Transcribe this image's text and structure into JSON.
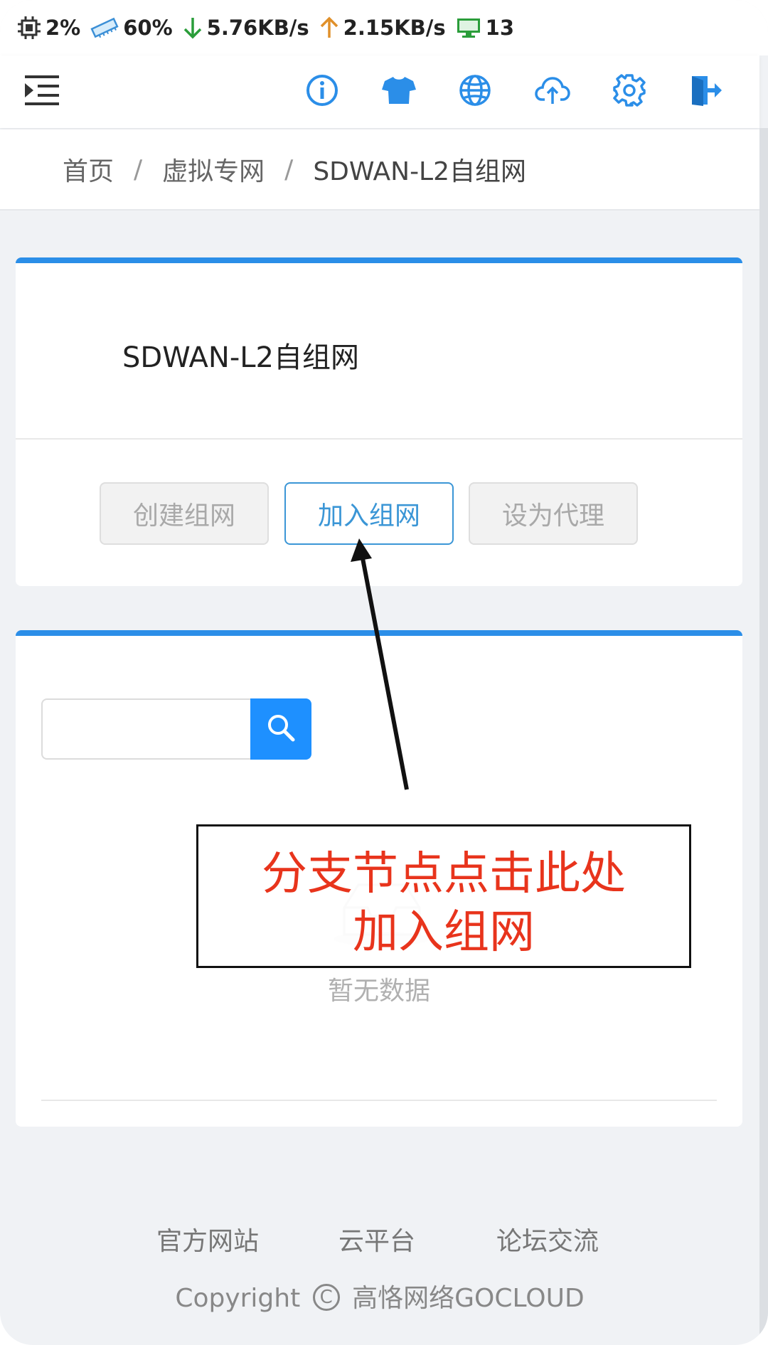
{
  "status_bar": {
    "cpu": "2%",
    "memory": "60%",
    "download": "5.76KB/s",
    "upload": "2.15KB/s",
    "devices": "13",
    "icons": [
      "cpu-icon",
      "memory-icon",
      "download-arrow-icon",
      "upload-arrow-icon",
      "monitor-icon"
    ],
    "colors": {
      "download": "#2a9d3a",
      "upload": "#e0902a",
      "devices": "#2a9d3a"
    }
  },
  "toolbar": {
    "left_icon": "menu-indent-icon",
    "right_icons": [
      "info-icon",
      "tshirt-icon",
      "globe-icon",
      "cloud-upload-icon",
      "gear-icon",
      "logout-icon"
    ],
    "icon_color": "#2b8ee8"
  },
  "breadcrumb": {
    "items": [
      "首页",
      "虚拟专网",
      "SDWAN-L2自组网"
    ],
    "separator": "/"
  },
  "network_card": {
    "title": "SDWAN-L2自组网",
    "buttons": {
      "create": "创建组网",
      "join": "加入组网",
      "proxy": "设为代理"
    },
    "accent": "#2b8ee8"
  },
  "list_card": {
    "search": {
      "placeholder": "",
      "value": ""
    },
    "empty_text": "暂无数据"
  },
  "annotation": {
    "line1": "分支节点点击此处",
    "line2": "加入组网",
    "color": "#e8341c"
  },
  "footer": {
    "links": [
      "官方网站",
      "云平台",
      "论坛交流"
    ],
    "copyright_prefix": "Copyright",
    "copyright_symbol": "C",
    "copyright_owner": "高恪网络GOCLOUD"
  }
}
